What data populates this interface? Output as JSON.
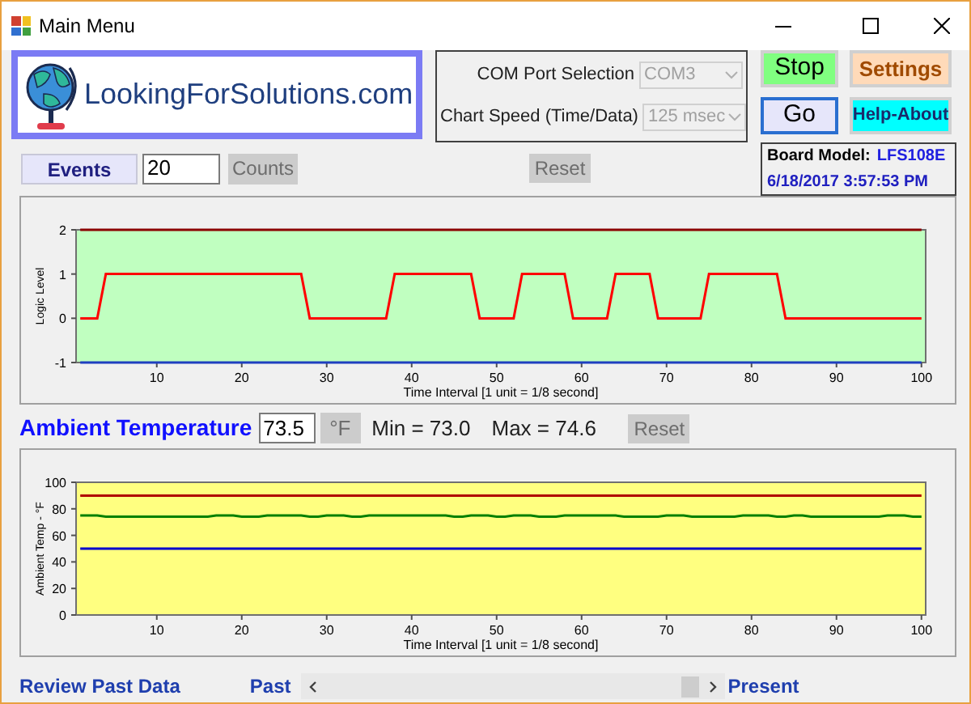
{
  "window": {
    "title": "Main Menu"
  },
  "logo": {
    "text": "LookingForSolutions.com"
  },
  "selectors": [
    {
      "label": "COM Port Selection",
      "value": "COM3",
      "disabled": true
    },
    {
      "label": "Chart Speed (Time/Data)",
      "value": "125 msec",
      "disabled": true
    }
  ],
  "buttons": [
    {
      "label": "Stop",
      "kind": "stop",
      "focused": false
    },
    {
      "label": "Settings",
      "kind": "settings",
      "focused": false
    },
    {
      "label": "Go",
      "kind": "go",
      "focused": true
    },
    {
      "label": "Help-About",
      "kind": "help",
      "focused": false
    }
  ],
  "board": {
    "label": "Board Model:",
    "model": "LFS108E",
    "timestamp": "6/18/2017 3:57:53 PM"
  },
  "events": {
    "button": "Events",
    "value": "20",
    "unit": {
      "label": "Counts",
      "disabled": true
    },
    "reset": {
      "label": "Reset",
      "disabled": true
    }
  },
  "logic_chart": {
    "chart_data": {
      "type": "line",
      "xlabel": "Time Interval [1 unit = 1/8 second]",
      "ylabel": "Logic Level",
      "x": [
        1,
        2,
        3,
        4,
        5,
        6,
        7,
        8,
        9,
        10,
        11,
        12,
        13,
        14,
        15,
        16,
        17,
        18,
        19,
        20,
        21,
        22,
        23,
        24,
        25,
        26,
        27,
        28,
        29,
        30,
        31,
        32,
        33,
        34,
        35,
        36,
        37,
        38,
        39,
        40,
        41,
        42,
        43,
        44,
        45,
        46,
        47,
        48,
        49,
        50,
        51,
        52,
        53,
        54,
        55,
        56,
        57,
        58,
        59,
        60,
        61,
        62,
        63,
        64,
        65,
        66,
        67,
        68,
        69,
        70,
        71,
        72,
        73,
        74,
        75,
        76,
        77,
        78,
        79,
        80,
        81,
        82,
        83,
        84,
        85,
        86,
        87,
        88,
        89,
        90,
        91,
        92,
        93,
        94,
        95,
        96,
        97,
        98,
        99,
        100
      ],
      "series": [
        {
          "color": "#8b0000",
          "values": [
            2,
            2,
            2,
            2,
            2,
            2,
            2,
            2,
            2,
            2,
            2,
            2,
            2,
            2,
            2,
            2,
            2,
            2,
            2,
            2,
            2,
            2,
            2,
            2,
            2,
            2,
            2,
            2,
            2,
            2,
            2,
            2,
            2,
            2,
            2,
            2,
            2,
            2,
            2,
            2,
            2,
            2,
            2,
            2,
            2,
            2,
            2,
            2,
            2,
            2,
            2,
            2,
            2,
            2,
            2,
            2,
            2,
            2,
            2,
            2,
            2,
            2,
            2,
            2,
            2,
            2,
            2,
            2,
            2,
            2,
            2,
            2,
            2,
            2,
            2,
            2,
            2,
            2,
            2,
            2,
            2,
            2,
            2,
            2,
            2,
            2,
            2,
            2,
            2,
            2,
            2,
            2,
            2,
            2,
            2,
            2,
            2,
            2,
            2,
            2
          ]
        },
        {
          "color": "#ff0000",
          "values": [
            0,
            0,
            0,
            1,
            1,
            1,
            1,
            1,
            1,
            1,
            1,
            1,
            1,
            1,
            1,
            1,
            1,
            1,
            1,
            1,
            1,
            1,
            1,
            1,
            1,
            1,
            1,
            0,
            0,
            0,
            0,
            0,
            0,
            0,
            0,
            0,
            0,
            1,
            1,
            1,
            1,
            1,
            1,
            1,
            1,
            1,
            1,
            0,
            0,
            0,
            0,
            0,
            1,
            1,
            1,
            1,
            1,
            1,
            0,
            0,
            0,
            0,
            0,
            1,
            1,
            1,
            1,
            1,
            0,
            0,
            0,
            0,
            0,
            0,
            1,
            1,
            1,
            1,
            1,
            1,
            1,
            1,
            1,
            0,
            0,
            0,
            0,
            0,
            0,
            0,
            0,
            0,
            0,
            0,
            0,
            0,
            0,
            0,
            0,
            0
          ]
        },
        {
          "color": "#1f3fbf",
          "values": [
            -1,
            -1,
            -1,
            -1,
            -1,
            -1,
            -1,
            -1,
            -1,
            -1,
            -1,
            -1,
            -1,
            -1,
            -1,
            -1,
            -1,
            -1,
            -1,
            -1,
            -1,
            -1,
            -1,
            -1,
            -1,
            -1,
            -1,
            -1,
            -1,
            -1,
            -1,
            -1,
            -1,
            -1,
            -1,
            -1,
            -1,
            -1,
            -1,
            -1,
            -1,
            -1,
            -1,
            -1,
            -1,
            -1,
            -1,
            -1,
            -1,
            -1,
            -1,
            -1,
            -1,
            -1,
            -1,
            -1,
            -1,
            -1,
            -1,
            -1,
            -1,
            -1,
            -1,
            -1,
            -1,
            -1,
            -1,
            -1,
            -1,
            -1,
            -1,
            -1,
            -1,
            -1,
            -1,
            -1,
            -1,
            -1,
            -1,
            -1,
            -1,
            -1,
            -1,
            -1,
            -1,
            -1,
            -1,
            -1,
            -1,
            -1,
            -1,
            -1,
            -1,
            -1,
            -1,
            -1,
            -1,
            -1,
            -1,
            -1
          ]
        }
      ],
      "xlim": [
        0.5,
        100.5
      ],
      "ylim": [
        -1,
        2
      ],
      "xticks": [
        10,
        20,
        30,
        40,
        50,
        60,
        70,
        80,
        90,
        100
      ],
      "yticks": [
        -1,
        0,
        1,
        2
      ]
    }
  },
  "temperature": {
    "label": "Ambient Temperature",
    "value": "73.5",
    "unit": {
      "label": "°F",
      "disabled": true
    },
    "min": "Min = 73.0",
    "max": "Max = 74.6",
    "reset": {
      "label": "Reset",
      "disabled": true
    }
  },
  "temp_chart": {
    "chart_data": {
      "type": "line",
      "xlabel": "Time Interval [1 unit = 1/8 second]",
      "ylabel": "Ambient Temp - °F",
      "x": [
        1,
        2,
        3,
        4,
        5,
        6,
        7,
        8,
        9,
        10,
        11,
        12,
        13,
        14,
        15,
        16,
        17,
        18,
        19,
        20,
        21,
        22,
        23,
        24,
        25,
        26,
        27,
        28,
        29,
        30,
        31,
        32,
        33,
        34,
        35,
        36,
        37,
        38,
        39,
        40,
        41,
        42,
        43,
        44,
        45,
        46,
        47,
        48,
        49,
        50,
        51,
        52,
        53,
        54,
        55,
        56,
        57,
        58,
        59,
        60,
        61,
        62,
        63,
        64,
        65,
        66,
        67,
        68,
        69,
        70,
        71,
        72,
        73,
        74,
        75,
        76,
        77,
        78,
        79,
        80,
        81,
        82,
        83,
        84,
        85,
        86,
        87,
        88,
        89,
        90,
        91,
        92,
        93,
        94,
        95,
        96,
        97,
        98,
        99,
        100
      ],
      "series": [
        {
          "color": "#b00000",
          "values": [
            90,
            90,
            90,
            90,
            90,
            90,
            90,
            90,
            90,
            90,
            90,
            90,
            90,
            90,
            90,
            90,
            90,
            90,
            90,
            90,
            90,
            90,
            90,
            90,
            90,
            90,
            90,
            90,
            90,
            90,
            90,
            90,
            90,
            90,
            90,
            90,
            90,
            90,
            90,
            90,
            90,
            90,
            90,
            90,
            90,
            90,
            90,
            90,
            90,
            90,
            90,
            90,
            90,
            90,
            90,
            90,
            90,
            90,
            90,
            90,
            90,
            90,
            90,
            90,
            90,
            90,
            90,
            90,
            90,
            90,
            90,
            90,
            90,
            90,
            90,
            90,
            90,
            90,
            90,
            90,
            90,
            90,
            90,
            90,
            90,
            90,
            90,
            90,
            90,
            90,
            90,
            90,
            90,
            90,
            90,
            90,
            90,
            90,
            90,
            90
          ]
        },
        {
          "color": "#008000",
          "values": [
            75,
            75,
            75,
            74,
            74,
            74,
            74,
            74,
            74,
            74,
            74,
            74,
            74,
            74,
            74,
            74,
            75,
            75,
            75,
            74,
            74,
            74,
            75,
            75,
            75,
            75,
            75,
            74,
            74,
            75,
            75,
            75,
            74,
            74,
            75,
            75,
            75,
            75,
            75,
            75,
            75,
            75,
            75,
            75,
            74,
            74,
            75,
            75,
            75,
            74,
            74,
            75,
            75,
            75,
            74,
            74,
            74,
            75,
            75,
            75,
            75,
            75,
            75,
            75,
            74,
            74,
            74,
            74,
            74,
            75,
            75,
            75,
            74,
            74,
            74,
            74,
            74,
            74,
            75,
            75,
            75,
            75,
            74,
            74,
            75,
            75,
            74,
            74,
            74,
            74,
            74,
            74,
            74,
            74,
            74,
            75,
            75,
            75,
            74,
            74
          ]
        },
        {
          "color": "#0000cc",
          "values": [
            50,
            50,
            50,
            50,
            50,
            50,
            50,
            50,
            50,
            50,
            50,
            50,
            50,
            50,
            50,
            50,
            50,
            50,
            50,
            50,
            50,
            50,
            50,
            50,
            50,
            50,
            50,
            50,
            50,
            50,
            50,
            50,
            50,
            50,
            50,
            50,
            50,
            50,
            50,
            50,
            50,
            50,
            50,
            50,
            50,
            50,
            50,
            50,
            50,
            50,
            50,
            50,
            50,
            50,
            50,
            50,
            50,
            50,
            50,
            50,
            50,
            50,
            50,
            50,
            50,
            50,
            50,
            50,
            50,
            50,
            50,
            50,
            50,
            50,
            50,
            50,
            50,
            50,
            50,
            50,
            50,
            50,
            50,
            50,
            50,
            50,
            50,
            50,
            50,
            50,
            50,
            50,
            50,
            50,
            50,
            50,
            50,
            50,
            50,
            50
          ]
        }
      ],
      "xlim": [
        0.5,
        100.5
      ],
      "ylim": [
        0,
        100
      ],
      "xticks": [
        10,
        20,
        30,
        40,
        50,
        60,
        70,
        80,
        90,
        100
      ],
      "yticks": [
        0,
        20,
        40,
        60,
        80,
        100
      ]
    }
  },
  "review": {
    "label": "Review Past Data",
    "past": "Past",
    "present": "Present"
  }
}
